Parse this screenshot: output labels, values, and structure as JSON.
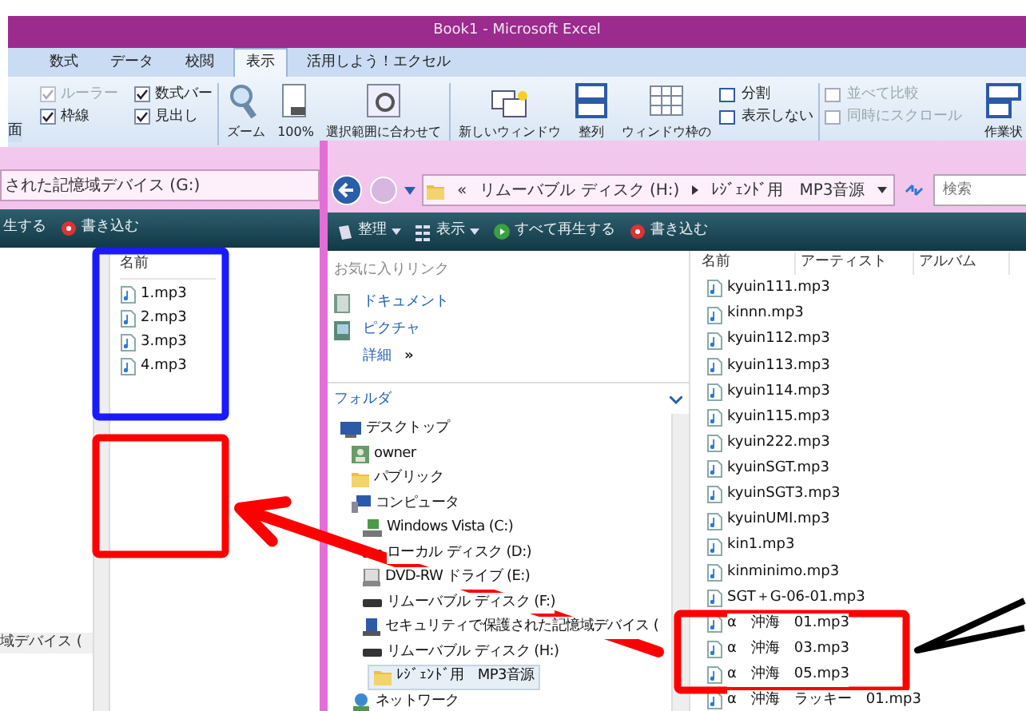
{
  "excel": {
    "title": "Book1 - Microsoft Excel",
    "tabs": [
      {
        "label": "数式",
        "selected": false
      },
      {
        "label": "データ",
        "selected": false
      },
      {
        "label": "校閲",
        "selected": false
      },
      {
        "label": "表示",
        "selected": true
      },
      {
        "label": "活用しよう！エクセル",
        "selected": false
      }
    ],
    "left_label": "面",
    "checkboxes": [
      {
        "label": "ルーラー",
        "checked": true,
        "disabled": true
      },
      {
        "label": "枠線",
        "checked": true,
        "disabled": false
      },
      {
        "label": "数式バー",
        "checked": true,
        "disabled": false
      },
      {
        "label": "見出し",
        "checked": true,
        "disabled": false
      }
    ],
    "buttons": [
      {
        "label": "ズーム",
        "kind": "zoom"
      },
      {
        "label": "100%",
        "kind": "page"
      },
      {
        "label": "選択範囲に合わせて",
        "kind": "fit"
      },
      {
        "label": "新しいウィンドウ",
        "kind": "newwin"
      },
      {
        "label": "整列",
        "kind": "arrange"
      },
      {
        "label": "ウィンドウ枠の",
        "kind": "freeze"
      }
    ],
    "small_buttons": [
      {
        "label": "分割",
        "disabled": false
      },
      {
        "label": "表示しない",
        "disabled": false
      },
      {
        "label": "並べて比較",
        "disabled": true
      },
      {
        "label": "同時にスクロール",
        "disabled": true
      }
    ],
    "right_label": "作業状"
  },
  "back_window": {
    "address": "された記憶域デバイス (G:)",
    "toolbar": [
      {
        "label": "生する",
        "kind": "text"
      },
      {
        "label": "書き込む",
        "kind": "burn"
      }
    ],
    "column": "名前",
    "files": [
      "1.mp3",
      "2.mp3",
      "3.mp3",
      "4.mp3"
    ],
    "tree_item": "域デバイス ("
  },
  "front_window": {
    "address_prefix": "«",
    "address": [
      "リムーバブル ディスク (H:)",
      "ﾚｼﾞｪﾝﾄﾞ用　MP3音源"
    ],
    "search": {
      "placeholder": "検索"
    },
    "toolbar": [
      {
        "label": "整理",
        "kind": "organize"
      },
      {
        "label": "表示",
        "kind": "views"
      },
      {
        "label": "すべて再生する",
        "kind": "play"
      },
      {
        "label": "書き込む",
        "kind": "burn"
      }
    ],
    "favorites": {
      "title": "お気に入りリンク",
      "items": [
        {
          "label": "ドキュメント",
          "kind": "documents"
        },
        {
          "label": "ピクチャ",
          "kind": "pictures"
        }
      ],
      "more": "詳細",
      "more_mark": "»"
    },
    "folders": {
      "title": "フォルダ",
      "tree": [
        {
          "label": "デスクトップ",
          "kind": "desktop",
          "selected": false,
          "children": [
            {
              "label": "owner",
              "kind": "user",
              "selected": false
            },
            {
              "label": "パブリック",
              "kind": "folder",
              "selected": false
            },
            {
              "label": "コンピュータ",
              "kind": "computer",
              "selected": false,
              "children": [
                {
                  "label": "Windows Vista (C:)",
                  "kind": "system",
                  "selected": false
                },
                {
                  "label": "ローカル ディスク (D:)",
                  "kind": "drive",
                  "selected": false
                },
                {
                  "label": "DVD-RW ドライブ (E:)",
                  "kind": "dvd",
                  "selected": false
                },
                {
                  "label": "リムーバブル ディスク (F:)",
                  "kind": "drive",
                  "selected": false
                },
                {
                  "label": "セキュリティで保護された記憶域デバイス (",
                  "kind": "secure",
                  "selected": false
                },
                {
                  "label": "リムーバブル ディスク (H:)",
                  "kind": "drive",
                  "selected": false,
                  "children": [
                    {
                      "label": "ﾚｼﾞｪﾝﾄﾞ用　MP3音源",
                      "kind": "folder",
                      "selected": true
                    }
                  ]
                }
              ]
            },
            {
              "label": "ネットワーク",
              "kind": "network",
              "selected": false
            }
          ]
        }
      ]
    },
    "columns": [
      "名前",
      "アーティスト",
      "アルバム"
    ],
    "files": [
      "kyuin111.mp3",
      "kinnn.mp3",
      "kyuin112.mp3",
      "kyuin113.mp3",
      "kyuin114.mp3",
      "kyuin115.mp3",
      "kyuin222.mp3",
      "kyuinSGT.mp3",
      "kyuinSGT3.mp3",
      "kyuinUMI.mp3",
      "kin1.mp3",
      "kinminimo.mp3",
      "SGT＋G-06-01.mp3",
      "α　沖海　01.mp3",
      "α　沖海　03.mp3",
      "α　沖海　05.mp3",
      "α　沖海　ラッキー　01.mp3"
    ]
  },
  "annotations": [
    {
      "kind": "rect",
      "color": "#1a1aff"
    },
    {
      "kind": "rect",
      "color": "#ff0000"
    },
    {
      "kind": "rect",
      "color": "#ff0000"
    },
    {
      "kind": "arrow",
      "color": "#ff0000"
    },
    {
      "kind": "chevron",
      "color": "#000000"
    }
  ]
}
